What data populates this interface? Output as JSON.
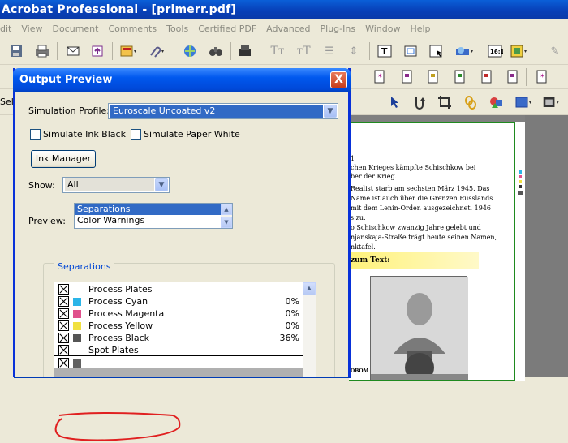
{
  "window": {
    "title": "Acrobat Professional - [primerr.pdf]"
  },
  "menu": [
    "dit",
    "View",
    "Document",
    "Comments",
    "Tools",
    "Certified PDF",
    "Advanced",
    "Plug-Ins",
    "Window",
    "Help"
  ],
  "toolbar3": {
    "partial_label": "Sel"
  },
  "dialog": {
    "title": "Output Preview",
    "close_glyph": "X",
    "simulation_profile_label": "Simulation Profile:",
    "simulation_profile_value": "Euroscale Uncoated v2",
    "simulate_ink_black": "Simulate Ink Black",
    "simulate_paper_white": "Simulate Paper White",
    "ink_manager": "Ink Manager",
    "show_label": "Show:",
    "show_value": "All",
    "preview_label": "Preview:",
    "preview_options": [
      "Separations",
      "Color Warnings"
    ],
    "preview_selected": "Separations",
    "separations_group": "Separations",
    "separations": [
      {
        "name": "Process Plates",
        "percent": "",
        "color": ""
      },
      {
        "name": "Process Cyan",
        "percent": "0%",
        "color": "#2bb5e8"
      },
      {
        "name": "Process Magenta",
        "percent": "0%",
        "color": "#e0508c"
      },
      {
        "name": "Process Yellow",
        "percent": "0%",
        "color": "#f0e040"
      },
      {
        "name": "Process Black",
        "percent": "36%",
        "color": "#555555"
      },
      {
        "name": "Spot Plates",
        "percent": "",
        "color": ""
      },
      {
        "name": "",
        "percent": "",
        "color": "#606060"
      }
    ]
  },
  "document": {
    "lines": [
      "1",
      "chen Krieges kämpfte Schischkow bei",
      "ber der Krieg.",
      "Realist starb am sechsten März 1945. Das",
      "Name ist auch über die Grenzen Russlands",
      "mit dem Lenin-Orden ausgezeichnet. 1946",
      "s zu.",
      "o Schischkow zwanzig Jahre gelebt und",
      "njanskaja-Straße trägt heute seinen Namen,",
      "nktafel."
    ],
    "heading": "zum Text:",
    "footer_fragment": "OBOM"
  },
  "colors": {
    "accent": "#0a5fd8",
    "annotation": "#e02020"
  }
}
